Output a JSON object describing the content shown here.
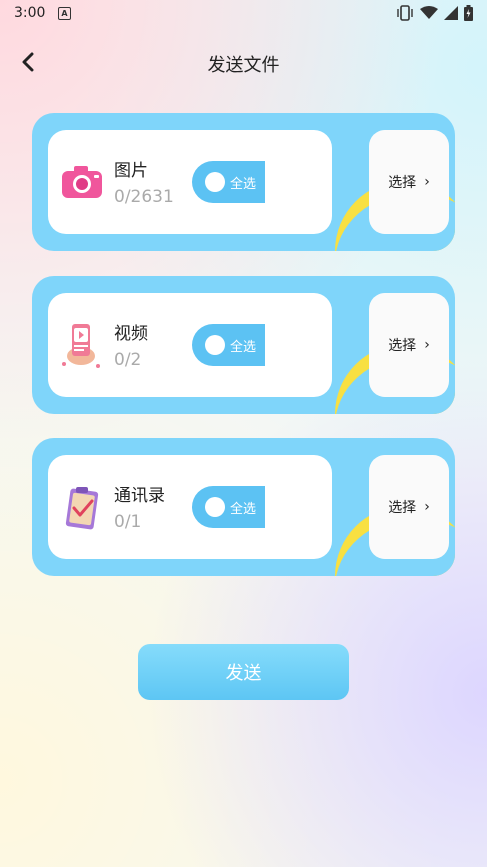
{
  "status_bar": {
    "time": "3:00",
    "badge": "A"
  },
  "header": {
    "title": "发送文件",
    "back_icon": "chevron-left-icon"
  },
  "categories": [
    {
      "name": "图片",
      "count": "0/2631",
      "toggle_label": "全选",
      "select_label": "选择",
      "icon": "camera-icon"
    },
    {
      "name": "视频",
      "count": "0/2",
      "toggle_label": "全选",
      "select_label": "选择",
      "icon": "video-phone-icon"
    },
    {
      "name": "通讯录",
      "count": "0/1",
      "toggle_label": "全选",
      "select_label": "选择",
      "icon": "clipboard-check-icon"
    }
  ],
  "send_button": {
    "label": "发送"
  },
  "colors": {
    "card": "#7fd5fa",
    "toggle": "#5cc2f3",
    "accent_yellow": "#f8e042",
    "send": "#5dc6f4"
  }
}
